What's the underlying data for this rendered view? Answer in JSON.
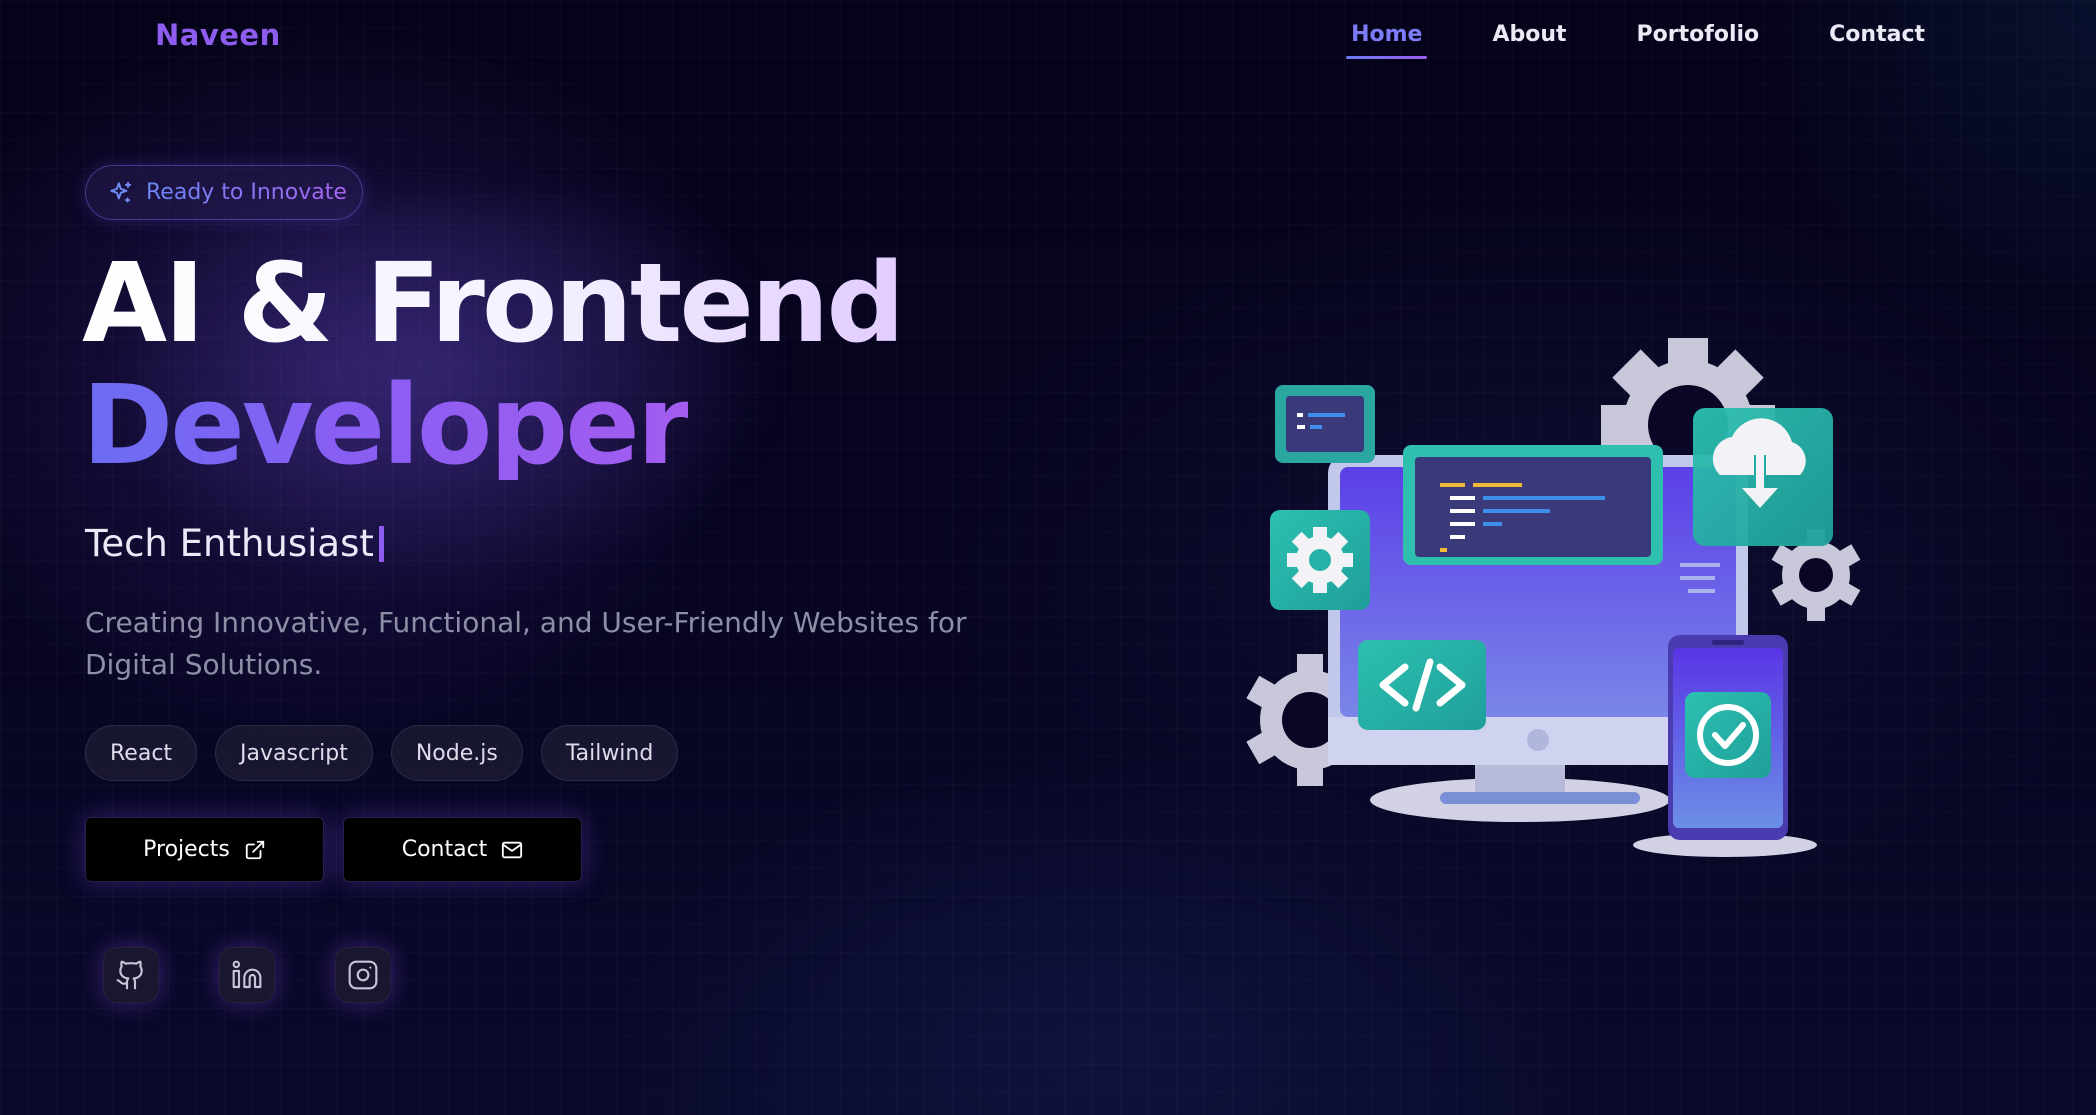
{
  "nav": {
    "logo": "Naveen",
    "items": [
      {
        "label": "Home",
        "active": true
      },
      {
        "label": "About",
        "active": false
      },
      {
        "label": "Portofolio",
        "active": false
      },
      {
        "label": "Contact",
        "active": false
      }
    ]
  },
  "hero": {
    "badge": "Ready to Innovate",
    "title_line1": "AI & Frontend",
    "title_line2": "Developer",
    "typed_text": "Tech Enthusiast",
    "description": "Creating Innovative, Functional, and User-Friendly Websites for Digital Solutions.",
    "tags": [
      "React",
      "Javascript",
      "Node.js",
      "Tailwind"
    ],
    "buttons": {
      "projects": {
        "label": "Projects",
        "icon": "external-link-icon"
      },
      "contact": {
        "label": "Contact",
        "icon": "mail-icon"
      }
    },
    "social": [
      {
        "name": "github",
        "icon": "github-icon"
      },
      {
        "name": "linkedin",
        "icon": "linkedin-icon"
      },
      {
        "name": "instagram",
        "icon": "instagram-icon"
      }
    ]
  },
  "colors": {
    "accent_purple": "#8f5cf0",
    "accent_blue": "#6b6df3",
    "background": "#05031a"
  }
}
